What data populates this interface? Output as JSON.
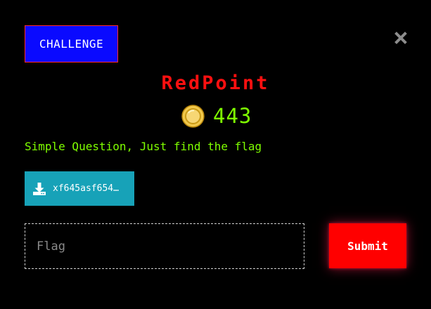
{
  "modal": {
    "tab_label": "CHALLENGE",
    "close_icon": "close-icon",
    "title": "RedPoint",
    "points_icon": "coin-icon",
    "points": "443",
    "description": "Simple Question, Just find the flag",
    "file": {
      "icon": "download-icon",
      "name": "xf645asf654…"
    },
    "flag_input": {
      "value": "",
      "placeholder": "Flag"
    },
    "submit_label": "Submit"
  },
  "colors": {
    "background": "#000000",
    "tab_bg": "#0a0aff",
    "tab_border": "#ff2a2a",
    "title": "#ff1010",
    "text_green": "#7fff00",
    "file_button": "#17a2b8",
    "submit_bg": "#ff0000"
  }
}
